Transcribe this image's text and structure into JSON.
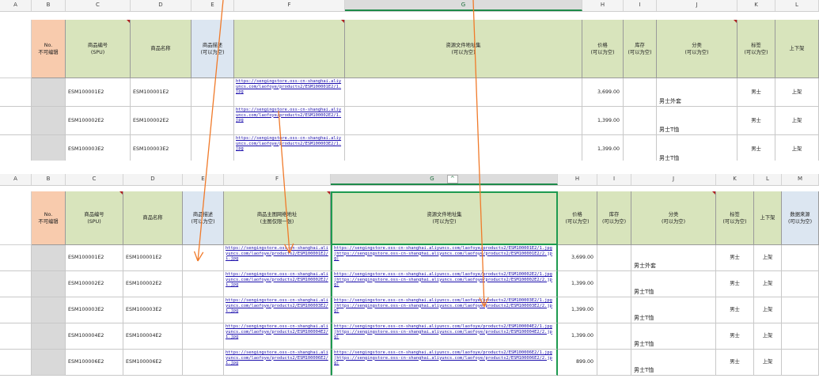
{
  "colors": {
    "header_green": "#d8e4bc",
    "header_orange": "#f8cbad",
    "header_blue": "#dce6f1",
    "data_col_b_gray": "#d9d9d9",
    "link_blue": "#1a0dab",
    "arrow_orange": "#f07a2a",
    "selection_green": "#1e9a50"
  },
  "top": {
    "col_letters": [
      "A",
      "B",
      "C",
      "D",
      "E",
      "F",
      "G",
      "H",
      "I",
      "J",
      "K",
      "L"
    ],
    "headers": {
      "no": [
        "No.",
        "不可编辑"
      ],
      "spu": [
        "商品编号",
        "(SPU)"
      ],
      "name": "商品名称",
      "desc": [
        "商品描述",
        "(可以为空)"
      ],
      "main_img": "",
      "resources": [
        "资源文件地址集",
        "(可以为空)"
      ],
      "price": [
        "价格",
        "(可以为空)"
      ],
      "stock": [
        "库存",
        "(可以为空)"
      ],
      "category": [
        "分类",
        "(可以为空)"
      ],
      "tag": [
        "标签",
        "(可以为空)"
      ],
      "shelf": "上下架"
    },
    "rows": [
      {
        "spu": "ESM100001E2",
        "name": "ESM100001E2",
        "img": "https://sengingstore.oss-cn-shanghai.aliyuncs.com/laofoye/products2/ESM100001E2/1.jpg",
        "price": "3,699.00",
        "category": "男士外套",
        "tag": "男士",
        "shelf": "上架"
      },
      {
        "spu": "ESM100002E2",
        "name": "ESM100002E2",
        "img": "https://sengingstore.oss-cn-shanghai.aliyuncs.com/laofoye/products2/ESM100002E2/1.jpg",
        "price": "1,399.00",
        "category": "男士T恤",
        "tag": "男士",
        "shelf": "上架"
      },
      {
        "spu": "ESM100003E2",
        "name": "ESM100003E2",
        "img": "https://sengingstore.oss-cn-shanghai.aliyuncs.com/laofoye/products2/ESM100003E2/1.jpg",
        "price": "1,399.00",
        "category": "男士T恤",
        "tag": "男士",
        "shelf": "上架"
      }
    ]
  },
  "bottom": {
    "col_letters": [
      "A",
      "B",
      "C",
      "D",
      "E",
      "F",
      "G",
      "H",
      "I",
      "J",
      "K",
      "L",
      "M"
    ],
    "g_col_caret": "^",
    "headers": {
      "no": [
        "No.",
        "不可编辑"
      ],
      "spu": [
        "商品编号",
        "(SPU)"
      ],
      "name": "商品名称",
      "desc": [
        "商品描述",
        "(可以为空)"
      ],
      "main_img": [
        "商品主图网络地址",
        "(主图仅限一张)"
      ],
      "resources": [
        "资源文件地址集",
        "(可以为空)"
      ],
      "price": [
        "价格",
        "(可以为空)"
      ],
      "stock": [
        "库存",
        "(可以为空)"
      ],
      "category": [
        "分类",
        "(可以为空)"
      ],
      "tag": [
        "标签",
        "(可以为空)"
      ],
      "shelf": "上下架",
      "source": [
        "数据来源",
        "(可以为空)"
      ]
    },
    "rows": [
      {
        "spu": "ESM100001E2",
        "name": "ESM100001E2",
        "img": "https://sengingstore.oss-cn-shanghai.aliyuncs.com/laofoye/products2/ESM100001E2/1.jpg",
        "res": "https://sengingstore.oss-cn-shanghai.aliyuncs.com/laofoye/products2/ESM100001E2/1.jpg|https://sengingstore.oss-cn-shanghai.aliyuncs.com/laofoye/products2/ESM100001E2/2.jpg|",
        "price": "3,699.00",
        "category": "男士外套",
        "tag": "男士",
        "shelf": "上架"
      },
      {
        "spu": "ESM100002E2",
        "name": "ESM100002E2",
        "img": "https://sengingstore.oss-cn-shanghai.aliyuncs.com/laofoye/products2/ESM100002E2/1.jpg",
        "res": "https://sengingstore.oss-cn-shanghai.aliyuncs.com/laofoye/products2/ESM100002E2/1.jpg|https://sengingstore.oss-cn-shanghai.aliyuncs.com/laofoye/products2/ESM100002E2/2.jpg|",
        "price": "1,399.00",
        "category": "男士T恤",
        "tag": "男士",
        "shelf": "上架"
      },
      {
        "spu": "ESM100003E2",
        "name": "ESM100003E2",
        "img": "https://sengingstore.oss-cn-shanghai.aliyuncs.com/laofoye/products2/ESM100003E2/1.jpg",
        "res": "https://sengingstore.oss-cn-shanghai.aliyuncs.com/laofoye/products2/ESM100003E2/1.jpg|https://sengingstore.oss-cn-shanghai.aliyuncs.com/laofoye/products2/ESM100003E2/2.jpg|",
        "price": "1,399.00",
        "category": "男士T恤",
        "tag": "男士",
        "shelf": "上架"
      },
      {
        "spu": "ESM100004E2",
        "name": "ESM100004E2",
        "img": "https://sengingstore.oss-cn-shanghai.aliyuncs.com/laofoye/products2/ESM100004E2/1.jpg",
        "res": "https://sengingstore.oss-cn-shanghai.aliyuncs.com/laofoye/products2/ESM100004E2/1.jpg|https://sengingstore.oss-cn-shanghai.aliyuncs.com/laofoye/products2/ESM100004E2/2.jpg|",
        "price": "1,399.00",
        "category": "男士T恤",
        "tag": "男士",
        "shelf": "上架"
      },
      {
        "spu": "ESM100006E2",
        "name": "ESM100006E2",
        "img": "https://sengingstore.oss-cn-shanghai.aliyuncs.com/laofoye/products2/ESM100006E2/1.jpg",
        "res": "https://sengingstore.oss-cn-shanghai.aliyuncs.com/laofoye/products2/ESM100006E2/1.jpg|https://sengingstore.oss-cn-shanghai.aliyuncs.com/laofoye/products2/ESM100006E2/2.jpg|",
        "price": "899.00",
        "category": "男士T恤",
        "tag": "男士",
        "shelf": "上架"
      }
    ]
  }
}
